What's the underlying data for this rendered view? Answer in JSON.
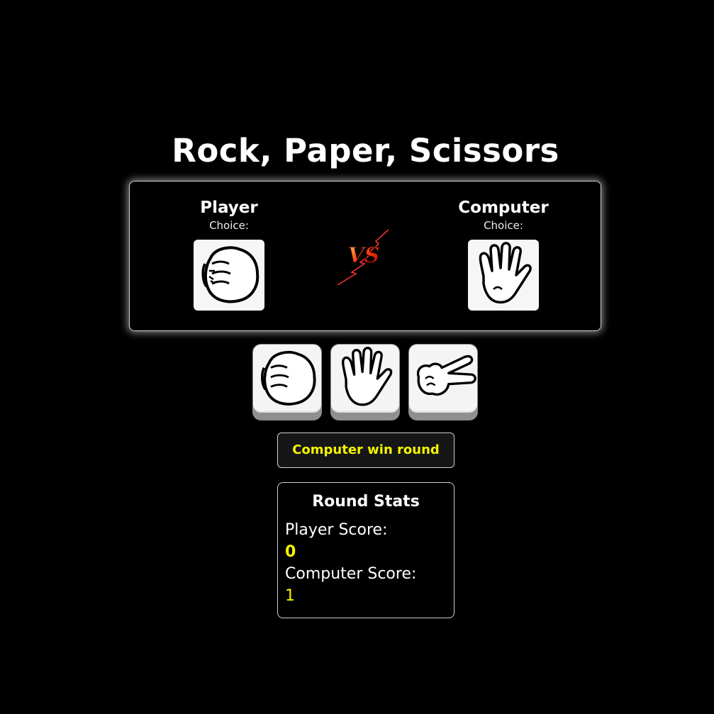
{
  "title": "Rock, Paper, Scissors",
  "arena": {
    "player": {
      "name": "Player",
      "choice_label": "Choice:",
      "choice_icon": "rock-hand-icon"
    },
    "computer": {
      "name": "Computer",
      "choice_label": "Choice:",
      "choice_icon": "paper-hand-icon"
    },
    "vs_text": "VS"
  },
  "controls": [
    {
      "name": "rock",
      "icon": "rock-hand-icon"
    },
    {
      "name": "paper",
      "icon": "paper-hand-icon"
    },
    {
      "name": "scissors",
      "icon": "scissors-hand-icon"
    }
  ],
  "result_text": "Computer win round",
  "stats": {
    "title": "Round Stats",
    "player_label": "Player Score:",
    "player_score": "0",
    "computer_label": "Computer Score:",
    "computer_score": "1"
  },
  "colors": {
    "background": "#000000",
    "accent_yellow": "#f5f500",
    "border": "#cfcfcf"
  }
}
